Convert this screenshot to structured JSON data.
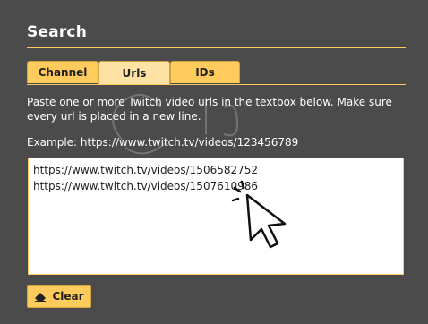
{
  "search": {
    "title": "Search",
    "tabs": [
      {
        "label": "Channel",
        "active": false
      },
      {
        "label": "Urls",
        "active": true
      },
      {
        "label": "IDs",
        "active": false
      }
    ],
    "instructions": "Paste one or more Twitch video urls in the textbox below. Make sure every url is placed in a new line.",
    "example": "Example: https://www.twitch.tv/videos/123456789",
    "textarea_lines": [
      "https://www.twitch.tv/videos/1506582752",
      "https://www.twitch.tv/videos/1507610986"
    ],
    "clear_label": "Clear",
    "clear_icon": "eraser-icon"
  },
  "colors": {
    "background": "#4b4b4b",
    "accent": "#ffcb5c",
    "active_tab": "#ffe3a6"
  }
}
